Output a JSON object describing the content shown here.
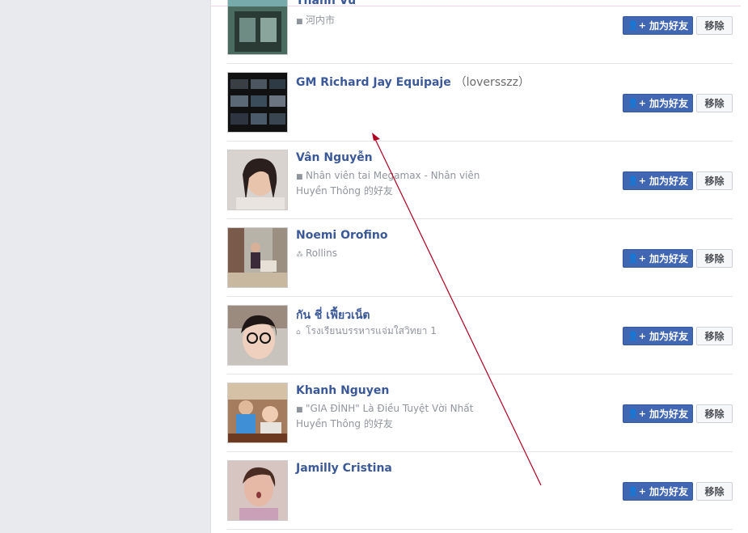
{
  "people": [
    {
      "name": "Thanh Vu",
      "alias": "",
      "sub1_icon": "work-icon",
      "sub1": "河内市",
      "sub2": ""
    },
    {
      "name": "GM Richard Jay Equipaje",
      "alias": "（loversszz）",
      "sub1_icon": "",
      "sub1": "",
      "sub2": ""
    },
    {
      "name": "Vân Nguyễn",
      "alias": "",
      "sub1_icon": "work-icon",
      "sub1": "Nhân viên tai Megamax - Nhân viên",
      "sub2": "Huyền Thông 的好友"
    },
    {
      "name": "Noemi Orofino",
      "alias": "",
      "sub1_icon": "network-icon",
      "sub1": "Rollins",
      "sub2": ""
    },
    {
      "name": "กัน ชี่ เฟี้ยวเน็ต",
      "alias": "",
      "sub1_icon": "school-icon",
      "sub1": "โรงเรียนบรรหารแจ่มใสวิทยา 1",
      "sub2": ""
    },
    {
      "name": "Khanh Nguyen",
      "alias": "",
      "sub1_icon": "work-icon",
      "sub1": "\"GIA ĐÌNH\" Là Điều Tuyệt Vời Nhất",
      "sub2": "Huyền Thông 的好友"
    },
    {
      "name": "Jamilly Cristina",
      "alias": "",
      "sub1_icon": "",
      "sub1": "",
      "sub2": ""
    }
  ],
  "buttons": {
    "add_friend": "加为好友",
    "remove": "移除"
  },
  "colors": {
    "link": "#3b5998",
    "primary": "#4267b2",
    "arrow": "#b00020"
  }
}
